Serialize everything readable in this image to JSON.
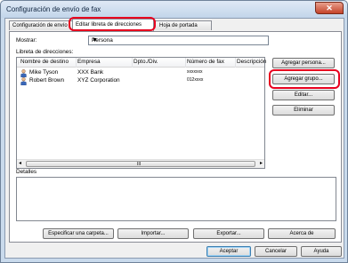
{
  "window": {
    "title": "Configuración de envío de fax",
    "close_glyph": "✕"
  },
  "tabs": [
    {
      "label": "Configuración de envío"
    },
    {
      "label": "Editar libreta de direcciones"
    },
    {
      "label": "Hoja de portada"
    }
  ],
  "mostrar": {
    "label": "Mostrar:",
    "value": "Persona"
  },
  "list": {
    "label": "Libreta de direcciones:",
    "columns": [
      "Nombre de destino",
      "Empresa",
      "Dpto./Div.",
      "Número de fax",
      "Descripción"
    ],
    "rows": [
      {
        "name": "Mike Tyson",
        "company": "XXX Bank",
        "dept": "",
        "fax": "xxxxxxx",
        "desc": ""
      },
      {
        "name": "Robert Brown",
        "company": "XYZ Corporation",
        "dept": "",
        "fax": "012xxxx",
        "desc": ""
      }
    ],
    "scroll_grip": "III"
  },
  "side_buttons": {
    "add_person": "Agregar persona...",
    "add_group": "Agregar grupo...",
    "edit": "Editar...",
    "delete": "Eliminar"
  },
  "details": {
    "label": "Detalles"
  },
  "bottom_buttons": {
    "specify_folder": "Especificar una carpeta...",
    "import": "Importar...",
    "export": "Exportar...",
    "about": "Acerca de"
  },
  "dialog_buttons": {
    "ok": "Aceptar",
    "cancel": "Cancelar",
    "help": "Ayuda"
  },
  "colors": {
    "highlight": "#e8001e",
    "title_bg": "#c9daec",
    "person_icon": "#3a67b8"
  }
}
